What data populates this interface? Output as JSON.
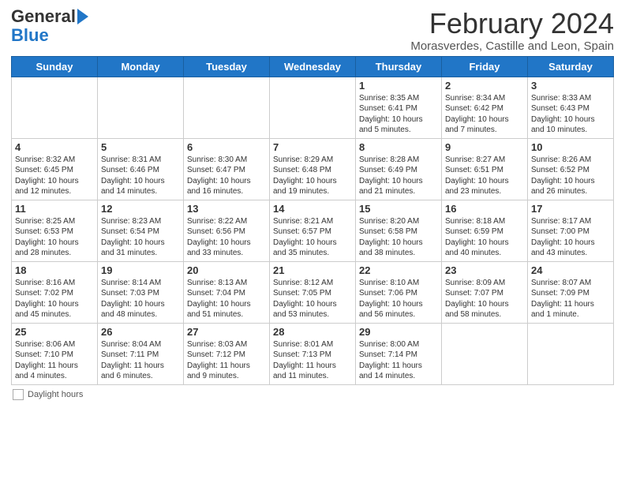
{
  "header": {
    "logo_general": "General",
    "logo_blue": "Blue",
    "main_title": "February 2024",
    "sub_title": "Morasverdes, Castille and Leon, Spain"
  },
  "calendar": {
    "days_of_week": [
      "Sunday",
      "Monday",
      "Tuesday",
      "Wednesday",
      "Thursday",
      "Friday",
      "Saturday"
    ],
    "weeks": [
      [
        {
          "day": "",
          "info": ""
        },
        {
          "day": "",
          "info": ""
        },
        {
          "day": "",
          "info": ""
        },
        {
          "day": "",
          "info": ""
        },
        {
          "day": "1",
          "info": "Sunrise: 8:35 AM\nSunset: 6:41 PM\nDaylight: 10 hours\nand 5 minutes."
        },
        {
          "day": "2",
          "info": "Sunrise: 8:34 AM\nSunset: 6:42 PM\nDaylight: 10 hours\nand 7 minutes."
        },
        {
          "day": "3",
          "info": "Sunrise: 8:33 AM\nSunset: 6:43 PM\nDaylight: 10 hours\nand 10 minutes."
        }
      ],
      [
        {
          "day": "4",
          "info": "Sunrise: 8:32 AM\nSunset: 6:45 PM\nDaylight: 10 hours\nand 12 minutes."
        },
        {
          "day": "5",
          "info": "Sunrise: 8:31 AM\nSunset: 6:46 PM\nDaylight: 10 hours\nand 14 minutes."
        },
        {
          "day": "6",
          "info": "Sunrise: 8:30 AM\nSunset: 6:47 PM\nDaylight: 10 hours\nand 16 minutes."
        },
        {
          "day": "7",
          "info": "Sunrise: 8:29 AM\nSunset: 6:48 PM\nDaylight: 10 hours\nand 19 minutes."
        },
        {
          "day": "8",
          "info": "Sunrise: 8:28 AM\nSunset: 6:49 PM\nDaylight: 10 hours\nand 21 minutes."
        },
        {
          "day": "9",
          "info": "Sunrise: 8:27 AM\nSunset: 6:51 PM\nDaylight: 10 hours\nand 23 minutes."
        },
        {
          "day": "10",
          "info": "Sunrise: 8:26 AM\nSunset: 6:52 PM\nDaylight: 10 hours\nand 26 minutes."
        }
      ],
      [
        {
          "day": "11",
          "info": "Sunrise: 8:25 AM\nSunset: 6:53 PM\nDaylight: 10 hours\nand 28 minutes."
        },
        {
          "day": "12",
          "info": "Sunrise: 8:23 AM\nSunset: 6:54 PM\nDaylight: 10 hours\nand 31 minutes."
        },
        {
          "day": "13",
          "info": "Sunrise: 8:22 AM\nSunset: 6:56 PM\nDaylight: 10 hours\nand 33 minutes."
        },
        {
          "day": "14",
          "info": "Sunrise: 8:21 AM\nSunset: 6:57 PM\nDaylight: 10 hours\nand 35 minutes."
        },
        {
          "day": "15",
          "info": "Sunrise: 8:20 AM\nSunset: 6:58 PM\nDaylight: 10 hours\nand 38 minutes."
        },
        {
          "day": "16",
          "info": "Sunrise: 8:18 AM\nSunset: 6:59 PM\nDaylight: 10 hours\nand 40 minutes."
        },
        {
          "day": "17",
          "info": "Sunrise: 8:17 AM\nSunset: 7:00 PM\nDaylight: 10 hours\nand 43 minutes."
        }
      ],
      [
        {
          "day": "18",
          "info": "Sunrise: 8:16 AM\nSunset: 7:02 PM\nDaylight: 10 hours\nand 45 minutes."
        },
        {
          "day": "19",
          "info": "Sunrise: 8:14 AM\nSunset: 7:03 PM\nDaylight: 10 hours\nand 48 minutes."
        },
        {
          "day": "20",
          "info": "Sunrise: 8:13 AM\nSunset: 7:04 PM\nDaylight: 10 hours\nand 51 minutes."
        },
        {
          "day": "21",
          "info": "Sunrise: 8:12 AM\nSunset: 7:05 PM\nDaylight: 10 hours\nand 53 minutes."
        },
        {
          "day": "22",
          "info": "Sunrise: 8:10 AM\nSunset: 7:06 PM\nDaylight: 10 hours\nand 56 minutes."
        },
        {
          "day": "23",
          "info": "Sunrise: 8:09 AM\nSunset: 7:07 PM\nDaylight: 10 hours\nand 58 minutes."
        },
        {
          "day": "24",
          "info": "Sunrise: 8:07 AM\nSunset: 7:09 PM\nDaylight: 11 hours\nand 1 minute."
        }
      ],
      [
        {
          "day": "25",
          "info": "Sunrise: 8:06 AM\nSunset: 7:10 PM\nDaylight: 11 hours\nand 4 minutes."
        },
        {
          "day": "26",
          "info": "Sunrise: 8:04 AM\nSunset: 7:11 PM\nDaylight: 11 hours\nand 6 minutes."
        },
        {
          "day": "27",
          "info": "Sunrise: 8:03 AM\nSunset: 7:12 PM\nDaylight: 11 hours\nand 9 minutes."
        },
        {
          "day": "28",
          "info": "Sunrise: 8:01 AM\nSunset: 7:13 PM\nDaylight: 11 hours\nand 11 minutes."
        },
        {
          "day": "29",
          "info": "Sunrise: 8:00 AM\nSunset: 7:14 PM\nDaylight: 11 hours\nand 14 minutes."
        },
        {
          "day": "",
          "info": ""
        },
        {
          "day": "",
          "info": ""
        }
      ]
    ]
  },
  "footer": {
    "legend_label": "Daylight hours"
  }
}
